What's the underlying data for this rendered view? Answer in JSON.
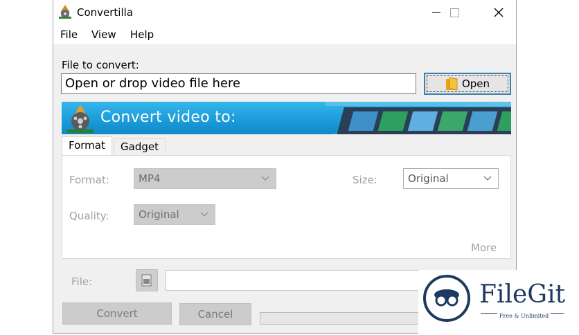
{
  "window": {
    "title": "Convertilla",
    "icon": "film-reel-icon",
    "controls": {
      "minimize": "—",
      "maximize": "☐",
      "close": "✕"
    }
  },
  "menu": {
    "items": [
      "File",
      "View",
      "Help"
    ]
  },
  "file_section": {
    "label": "File to convert:",
    "input_value": "Open or drop video file here",
    "open_button_label": "Open",
    "open_icon": "folder-icon"
  },
  "banner": {
    "title": "Convert video to:"
  },
  "tabs": [
    {
      "label": "Format",
      "active": true
    },
    {
      "label": "Gadget",
      "active": false
    }
  ],
  "format_panel": {
    "format_label": "Format:",
    "format_value": "MP4",
    "size_label": "Size:",
    "size_value": "Original",
    "quality_label": "Quality:",
    "quality_value": "Original",
    "more_link": "More"
  },
  "output": {
    "file_label": "File:",
    "file_value": ""
  },
  "buttons": {
    "convert": "Convert",
    "cancel": "Cancel"
  },
  "progress": {
    "percent": 0
  },
  "watermark": {
    "brand": "FileGit",
    "tagline": "Free & Unlimited"
  },
  "colors": {
    "banner": "#1a9ad8",
    "accent": "#3c7fb1",
    "watermark": "#1f3a5f"
  }
}
